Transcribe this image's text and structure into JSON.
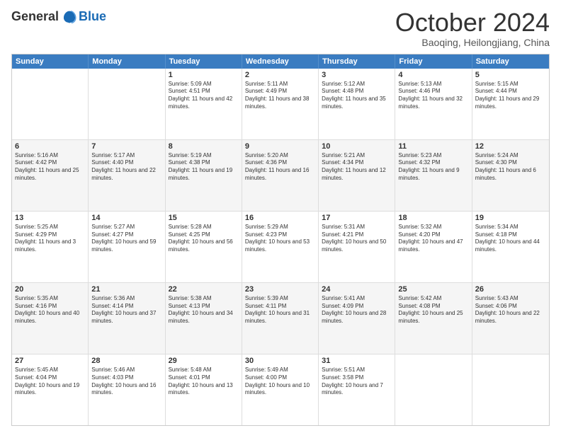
{
  "header": {
    "logo_general": "General",
    "logo_blue": "Blue",
    "month_title": "October 2024",
    "subtitle": "Baoqing, Heilongjiang, China"
  },
  "weekdays": [
    "Sunday",
    "Monday",
    "Tuesday",
    "Wednesday",
    "Thursday",
    "Friday",
    "Saturday"
  ],
  "rows": [
    {
      "alt": false,
      "cells": [
        {
          "day": "",
          "sunrise": "",
          "sunset": "",
          "daylight": ""
        },
        {
          "day": "",
          "sunrise": "",
          "sunset": "",
          "daylight": ""
        },
        {
          "day": "1",
          "sunrise": "Sunrise: 5:09 AM",
          "sunset": "Sunset: 4:51 PM",
          "daylight": "Daylight: 11 hours and 42 minutes."
        },
        {
          "day": "2",
          "sunrise": "Sunrise: 5:11 AM",
          "sunset": "Sunset: 4:49 PM",
          "daylight": "Daylight: 11 hours and 38 minutes."
        },
        {
          "day": "3",
          "sunrise": "Sunrise: 5:12 AM",
          "sunset": "Sunset: 4:48 PM",
          "daylight": "Daylight: 11 hours and 35 minutes."
        },
        {
          "day": "4",
          "sunrise": "Sunrise: 5:13 AM",
          "sunset": "Sunset: 4:46 PM",
          "daylight": "Daylight: 11 hours and 32 minutes."
        },
        {
          "day": "5",
          "sunrise": "Sunrise: 5:15 AM",
          "sunset": "Sunset: 4:44 PM",
          "daylight": "Daylight: 11 hours and 29 minutes."
        }
      ]
    },
    {
      "alt": true,
      "cells": [
        {
          "day": "6",
          "sunrise": "Sunrise: 5:16 AM",
          "sunset": "Sunset: 4:42 PM",
          "daylight": "Daylight: 11 hours and 25 minutes."
        },
        {
          "day": "7",
          "sunrise": "Sunrise: 5:17 AM",
          "sunset": "Sunset: 4:40 PM",
          "daylight": "Daylight: 11 hours and 22 minutes."
        },
        {
          "day": "8",
          "sunrise": "Sunrise: 5:19 AM",
          "sunset": "Sunset: 4:38 PM",
          "daylight": "Daylight: 11 hours and 19 minutes."
        },
        {
          "day": "9",
          "sunrise": "Sunrise: 5:20 AM",
          "sunset": "Sunset: 4:36 PM",
          "daylight": "Daylight: 11 hours and 16 minutes."
        },
        {
          "day": "10",
          "sunrise": "Sunrise: 5:21 AM",
          "sunset": "Sunset: 4:34 PM",
          "daylight": "Daylight: 11 hours and 12 minutes."
        },
        {
          "day": "11",
          "sunrise": "Sunrise: 5:23 AM",
          "sunset": "Sunset: 4:32 PM",
          "daylight": "Daylight: 11 hours and 9 minutes."
        },
        {
          "day": "12",
          "sunrise": "Sunrise: 5:24 AM",
          "sunset": "Sunset: 4:30 PM",
          "daylight": "Daylight: 11 hours and 6 minutes."
        }
      ]
    },
    {
      "alt": false,
      "cells": [
        {
          "day": "13",
          "sunrise": "Sunrise: 5:25 AM",
          "sunset": "Sunset: 4:29 PM",
          "daylight": "Daylight: 11 hours and 3 minutes."
        },
        {
          "day": "14",
          "sunrise": "Sunrise: 5:27 AM",
          "sunset": "Sunset: 4:27 PM",
          "daylight": "Daylight: 10 hours and 59 minutes."
        },
        {
          "day": "15",
          "sunrise": "Sunrise: 5:28 AM",
          "sunset": "Sunset: 4:25 PM",
          "daylight": "Daylight: 10 hours and 56 minutes."
        },
        {
          "day": "16",
          "sunrise": "Sunrise: 5:29 AM",
          "sunset": "Sunset: 4:23 PM",
          "daylight": "Daylight: 10 hours and 53 minutes."
        },
        {
          "day": "17",
          "sunrise": "Sunrise: 5:31 AM",
          "sunset": "Sunset: 4:21 PM",
          "daylight": "Daylight: 10 hours and 50 minutes."
        },
        {
          "day": "18",
          "sunrise": "Sunrise: 5:32 AM",
          "sunset": "Sunset: 4:20 PM",
          "daylight": "Daylight: 10 hours and 47 minutes."
        },
        {
          "day": "19",
          "sunrise": "Sunrise: 5:34 AM",
          "sunset": "Sunset: 4:18 PM",
          "daylight": "Daylight: 10 hours and 44 minutes."
        }
      ]
    },
    {
      "alt": true,
      "cells": [
        {
          "day": "20",
          "sunrise": "Sunrise: 5:35 AM",
          "sunset": "Sunset: 4:16 PM",
          "daylight": "Daylight: 10 hours and 40 minutes."
        },
        {
          "day": "21",
          "sunrise": "Sunrise: 5:36 AM",
          "sunset": "Sunset: 4:14 PM",
          "daylight": "Daylight: 10 hours and 37 minutes."
        },
        {
          "day": "22",
          "sunrise": "Sunrise: 5:38 AM",
          "sunset": "Sunset: 4:13 PM",
          "daylight": "Daylight: 10 hours and 34 minutes."
        },
        {
          "day": "23",
          "sunrise": "Sunrise: 5:39 AM",
          "sunset": "Sunset: 4:11 PM",
          "daylight": "Daylight: 10 hours and 31 minutes."
        },
        {
          "day": "24",
          "sunrise": "Sunrise: 5:41 AM",
          "sunset": "Sunset: 4:09 PM",
          "daylight": "Daylight: 10 hours and 28 minutes."
        },
        {
          "day": "25",
          "sunrise": "Sunrise: 5:42 AM",
          "sunset": "Sunset: 4:08 PM",
          "daylight": "Daylight: 10 hours and 25 minutes."
        },
        {
          "day": "26",
          "sunrise": "Sunrise: 5:43 AM",
          "sunset": "Sunset: 4:06 PM",
          "daylight": "Daylight: 10 hours and 22 minutes."
        }
      ]
    },
    {
      "alt": false,
      "cells": [
        {
          "day": "27",
          "sunrise": "Sunrise: 5:45 AM",
          "sunset": "Sunset: 4:04 PM",
          "daylight": "Daylight: 10 hours and 19 minutes."
        },
        {
          "day": "28",
          "sunrise": "Sunrise: 5:46 AM",
          "sunset": "Sunset: 4:03 PM",
          "daylight": "Daylight: 10 hours and 16 minutes."
        },
        {
          "day": "29",
          "sunrise": "Sunrise: 5:48 AM",
          "sunset": "Sunset: 4:01 PM",
          "daylight": "Daylight: 10 hours and 13 minutes."
        },
        {
          "day": "30",
          "sunrise": "Sunrise: 5:49 AM",
          "sunset": "Sunset: 4:00 PM",
          "daylight": "Daylight: 10 hours and 10 minutes."
        },
        {
          "day": "31",
          "sunrise": "Sunrise: 5:51 AM",
          "sunset": "Sunset: 3:58 PM",
          "daylight": "Daylight: 10 hours and 7 minutes."
        },
        {
          "day": "",
          "sunrise": "",
          "sunset": "",
          "daylight": ""
        },
        {
          "day": "",
          "sunrise": "",
          "sunset": "",
          "daylight": ""
        }
      ]
    }
  ]
}
